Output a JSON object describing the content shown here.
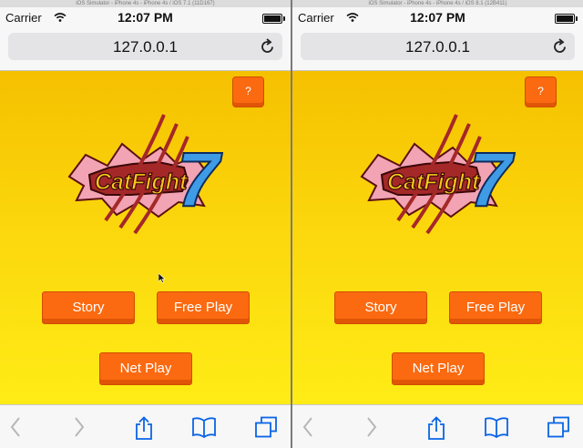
{
  "screens": [
    {
      "simulator_title": "iOS Simulator - iPhone 4s - iPhone 4s / iOS 7.1 (11D167)",
      "status": {
        "carrier": "Carrier",
        "time": "12:07 PM"
      },
      "url": "127.0.0.1",
      "app": {
        "help_label": "?",
        "logo_text": "CatFight",
        "logo_number": "7",
        "buttons": {
          "story": "Story",
          "free_play": "Free Play",
          "net_play": "Net Play"
        }
      }
    },
    {
      "simulator_title": "iOS Simulator - iPhone 4s - iPhone 4s / iOS 8.1 (12B411)",
      "status": {
        "carrier": "Carrier",
        "time": "12:07 PM"
      },
      "url": "127.0.0.1",
      "app": {
        "help_label": "?",
        "logo_text": "CatFight",
        "logo_number": "7",
        "buttons": {
          "story": "Story",
          "free_play": "Free Play",
          "net_play": "Net Play"
        }
      }
    }
  ],
  "colors": {
    "background_yellow": "#f6d400",
    "button_orange": "#fb6a10",
    "logo_red": "#a52828",
    "logo_pink": "#f2a3b4",
    "logo_text_yellow": "#f8c81a",
    "logo_blue": "#3f9be6",
    "chrome_gray": "#f7f7f7"
  },
  "icons": [
    "wifi-icon",
    "battery-icon",
    "reload-icon",
    "back-icon",
    "forward-icon",
    "share-icon",
    "bookmarks-icon",
    "tabs-icon",
    "mouse-cursor-icon"
  ]
}
